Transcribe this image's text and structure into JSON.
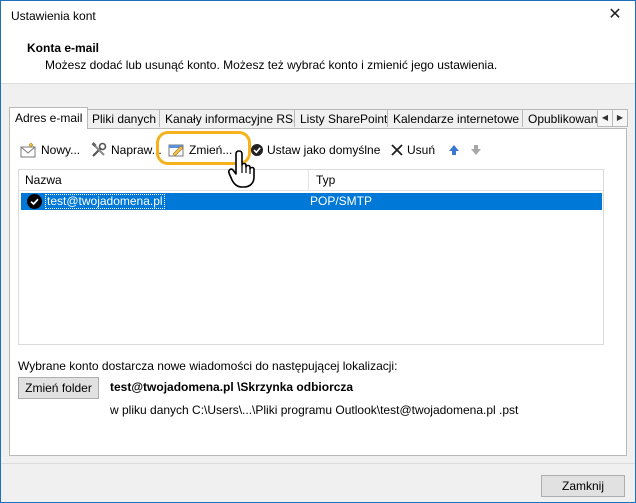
{
  "window": {
    "title": "Ustawienia kont",
    "close_glyph": "✕"
  },
  "header": {
    "title": "Konta e-mail",
    "description": "Możesz dodać lub usunąć konto. Możesz też wybrać konto i zmienić jego ustawienia."
  },
  "tabs": [
    {
      "label": "Adres e-mail",
      "active": true
    },
    {
      "label": "Pliki danych"
    },
    {
      "label": "Kanały informacyjne RSS"
    },
    {
      "label": "Listy SharePoint"
    },
    {
      "label": "Kalendarze internetowe"
    },
    {
      "label": "Opublikowane"
    }
  ],
  "tab_scroll": {
    "left": "◀",
    "right": "▶"
  },
  "toolbar": {
    "new_label": "Nowy...",
    "repair_label": "Napraw...",
    "change_label": "Zmień...",
    "set_default_label": "Ustaw jako domyślne",
    "remove_label": "Usuń"
  },
  "accounts_list": {
    "columns": [
      "Nazwa",
      "Typ"
    ],
    "rows": [
      {
        "name": "test@twojadomena.pl",
        "type": "POP/SMTP",
        "selected": true
      }
    ]
  },
  "delivery": {
    "label": "Wybrane konto dostarcza nowe wiadomości do następującej lokalizacji:",
    "change_folder_label": "Zmień folder",
    "account": "test@twojadomena.pl",
    "folder": "\\Skrzynka odbiorcza",
    "file_path": "w pliku danych C:\\Users\\...\\Pliki programu Outlook\\test@twojadomena.pl .pst"
  },
  "footer": {
    "close_label": "Zamknij"
  },
  "colors": {
    "selection": "#0078d7",
    "highlight_ring": "#f5b21a",
    "window_border": "#1f6fbf"
  }
}
